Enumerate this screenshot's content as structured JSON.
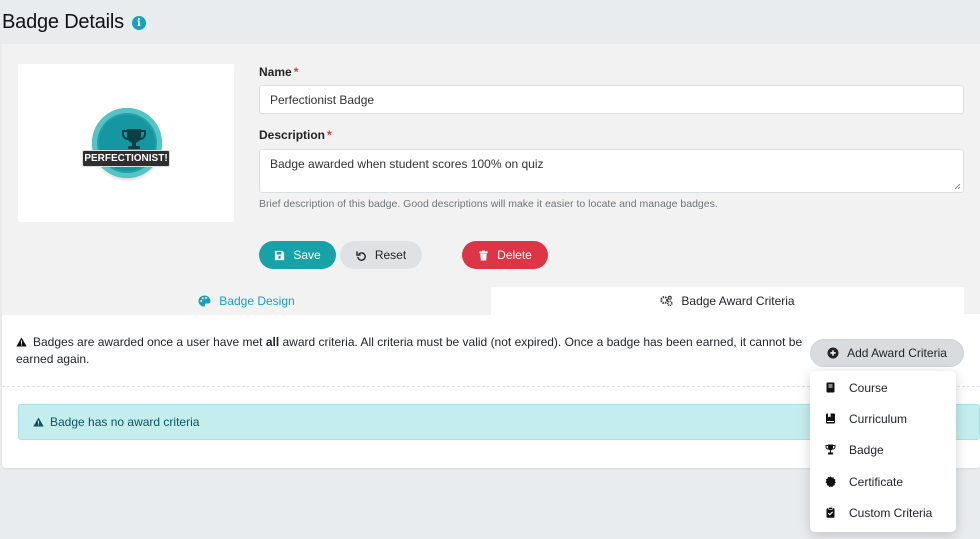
{
  "header": {
    "title": "Badge Details",
    "info_icon": "info-icon"
  },
  "badge_image": {
    "ribbon_text": "PERFECTIONIST!",
    "icon": "trophy-icon",
    "color": "#1fa3a6"
  },
  "form": {
    "name_label": "Name",
    "name_value": "Perfectionist Badge",
    "description_label": "Description",
    "description_value": "Badge awarded when student scores 100% on quiz",
    "required_marker": "*",
    "description_help": "Brief description of this badge. Good descriptions will make it easier to locate and manage badges."
  },
  "buttons": {
    "save": "Save",
    "reset": "Reset",
    "delete": "Delete"
  },
  "tabs": [
    {
      "label": "Badge Design",
      "icon": "palette-icon"
    },
    {
      "label": "Badge Award Criteria",
      "icon": "gears-icon"
    }
  ],
  "criteria": {
    "notice_before": "Badges are awarded once a user have met ",
    "notice_bold": "all",
    "notice_after": " award criteria. All criteria must be valid (not expired). Once a badge has been earned, it cannot be earned again.",
    "empty_alert": "Badge has no award criteria",
    "add_button": "Add Award Criteria",
    "dropdown": [
      {
        "label": "Course",
        "icon": "book-icon"
      },
      {
        "label": "Curriculum",
        "icon": "book-bookmark-icon"
      },
      {
        "label": "Badge",
        "icon": "trophy-icon"
      },
      {
        "label": "Certificate",
        "icon": "certificate-icon"
      },
      {
        "label": "Custom Criteria",
        "icon": "clipboard-check-icon"
      }
    ]
  },
  "colors": {
    "primary": "#17a2b8",
    "danger": "#dc3545",
    "alert_bg": "#c4eded"
  }
}
